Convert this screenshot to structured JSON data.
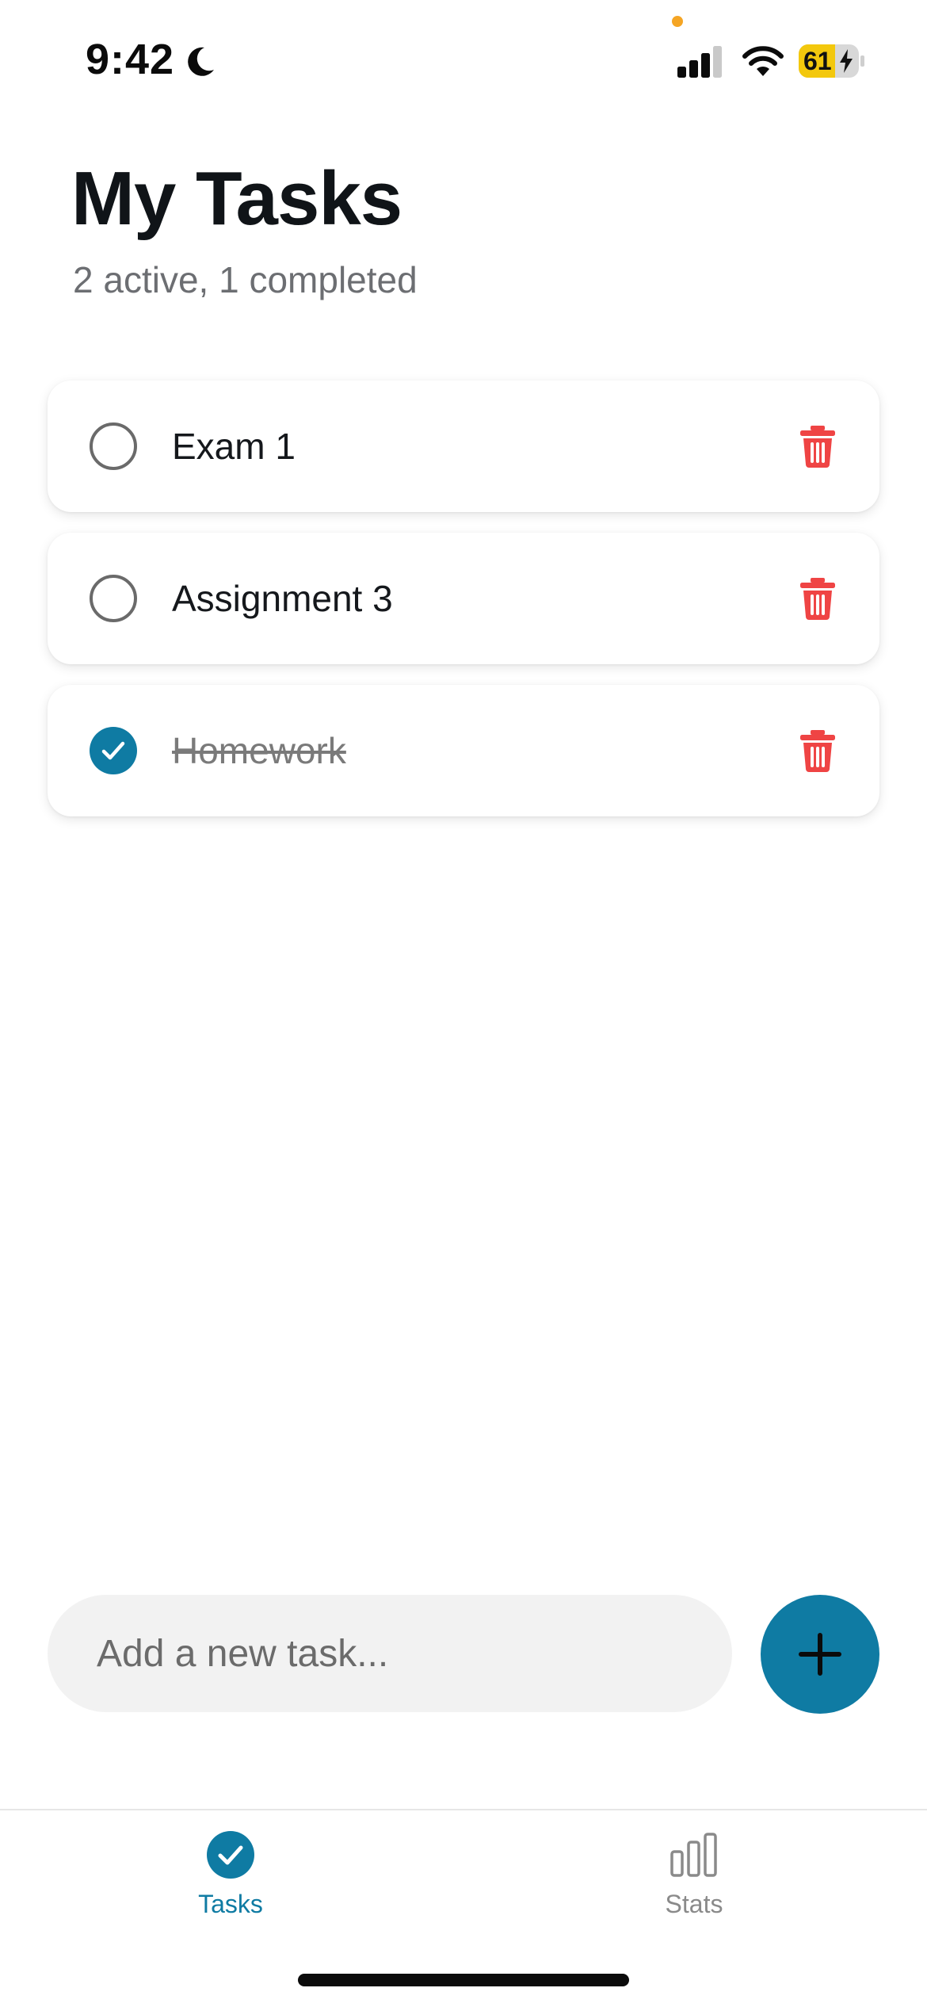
{
  "status_bar": {
    "time": "9:42",
    "battery_level": "61",
    "battery_fraction": 0.61,
    "icons": [
      "moon-icon",
      "signal-icon",
      "wifi-icon",
      "battery-icon",
      "charging-bolt-icon"
    ]
  },
  "header": {
    "title": "My Tasks",
    "subtitle": "2 active, 1 completed"
  },
  "tasks": [
    {
      "label": "Exam 1",
      "completed": false
    },
    {
      "label": "Assignment 3",
      "completed": false
    },
    {
      "label": "Homework",
      "completed": true
    }
  ],
  "input": {
    "placeholder": "Add a new task...",
    "value": ""
  },
  "tab_bar": {
    "tasks_label": "Tasks",
    "stats_label": "Stats",
    "active": "Tasks"
  },
  "colors": {
    "accent": "#0f7ba3",
    "delete": "#ef4444",
    "battery": "#f3c80d"
  }
}
